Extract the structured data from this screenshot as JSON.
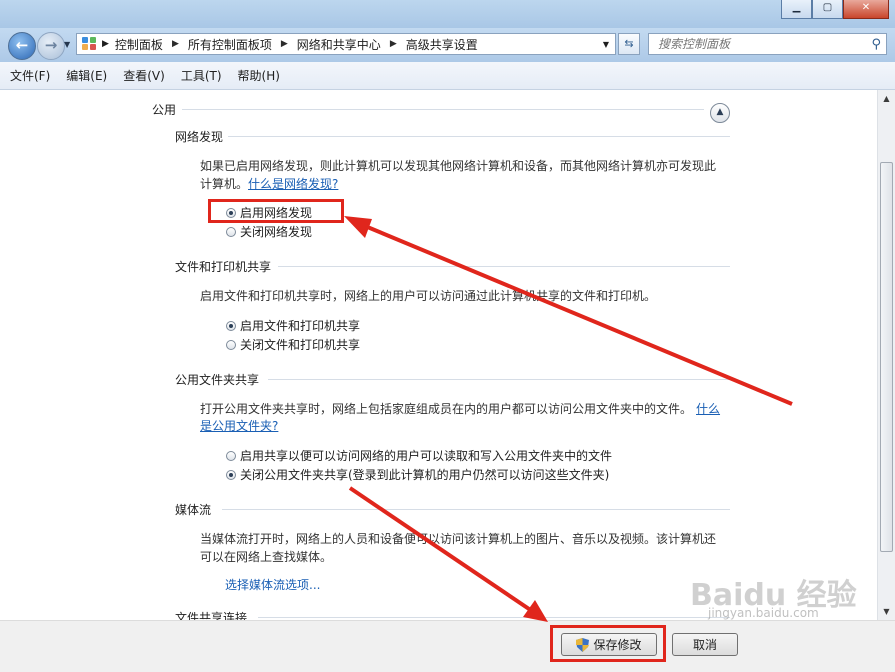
{
  "window": {
    "minimize": "▁",
    "maximize": "▢",
    "close": "✕"
  },
  "address": {
    "breadcrumbs": [
      "控制面板",
      "所有控制面板项",
      "网络和共享中心",
      "高级共享设置"
    ],
    "search_placeholder": "搜索控制面板"
  },
  "menu": [
    "文件(F)",
    "编辑(E)",
    "查看(V)",
    "工具(T)",
    "帮助(H)"
  ],
  "profile": {
    "title": "公用"
  },
  "network_discovery": {
    "title": "网络发现",
    "desc1": "如果已启用网络发现，则此计算机可以发现其他网络计算机和设备，而其他网络计算机亦可发现此",
    "desc2": "计算机。",
    "link": "什么是网络发现?",
    "options": [
      "启用网络发现",
      "关闭网络发现"
    ],
    "selected": 0
  },
  "file_printer": {
    "title": "文件和打印机共享",
    "desc": "启用文件和打印机共享时，网络上的用户可以访问通过此计算机共享的文件和打印机。",
    "options": [
      "启用文件和打印机共享",
      "关闭文件和打印机共享"
    ],
    "selected": 0
  },
  "public_folder": {
    "title": "公用文件夹共享",
    "desc1": "打开公用文件夹共享时，网络上包括家庭组成员在内的用户都可以访问公用文件夹中的文件。",
    "link1": "什么",
    "link2": "是公用文件夹?",
    "options": [
      "启用共享以便可以访问网络的用户可以读取和写入公用文件夹中的文件",
      "关闭公用文件夹共享(登录到此计算机的用户仍然可以访问这些文件夹)"
    ],
    "selected": 1
  },
  "media": {
    "title": "媒体流",
    "desc1": "当媒体流打开时，网络上的人员和设备便可以访问该计算机上的图片、音乐以及视频。该计算机还",
    "desc2": "可以在网络上查找媒体。",
    "link": "选择媒体流选项..."
  },
  "file_sharing_connections": {
    "title": "文件共享连接"
  },
  "footer": {
    "save": "保存修改",
    "cancel": "取消"
  },
  "watermark": {
    "brand": "Baidu 经验",
    "url": "jingyan.baidu.com"
  },
  "colors": {
    "annotation": "#e0261c",
    "link": "#1a5fb4"
  }
}
